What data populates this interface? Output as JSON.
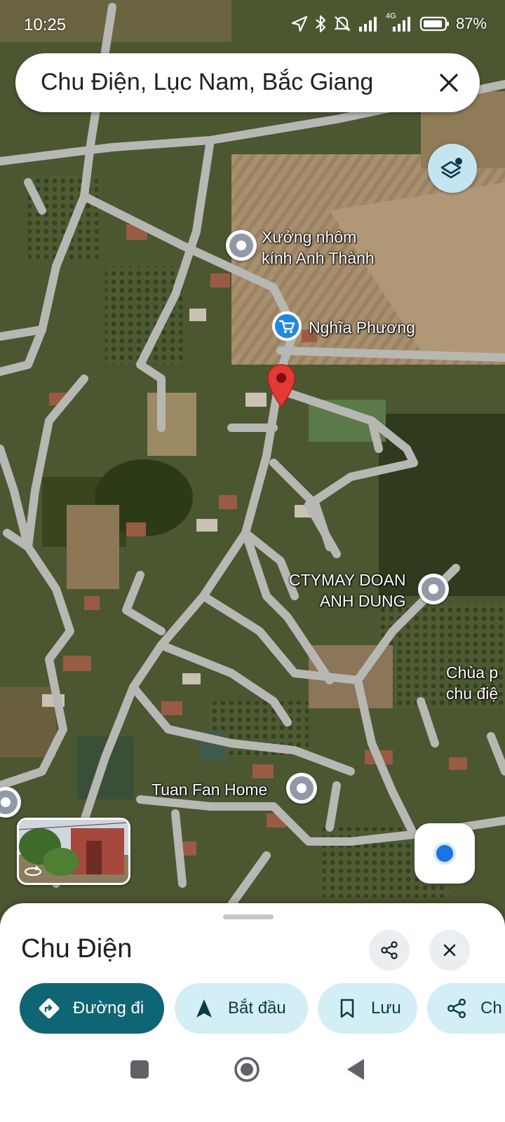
{
  "status_bar": {
    "time": "10:25",
    "network": "4G",
    "battery": "87%"
  },
  "search": {
    "query": "Chu Điện, Lục Nam, Bắc Giang",
    "clear_icon": "close-icon"
  },
  "map": {
    "layers_icon": "layers-icon",
    "selected_pin_color": "#e53935",
    "pois": [
      {
        "label": "Xưởng nhôm\nkính Anh Thành",
        "icon": "place-pin-gray"
      },
      {
        "label": "Nghĩa Phương",
        "icon": "shopping-cart-pin"
      },
      {
        "label": "CTYMAY DOAN\nANH DUNG",
        "icon": "place-pin-gray"
      },
      {
        "label": "Chùa p\nchu điệ",
        "icon": "none"
      },
      {
        "label": "Tuan Fan Home",
        "icon": "place-pin-gray"
      }
    ],
    "street_view_icon": "rotate-360-icon",
    "my_location_icon": "my-location-dot"
  },
  "sheet": {
    "title": "Chu Điện",
    "share_icon": "share-icon",
    "close_icon": "close-icon",
    "actions": [
      {
        "label": "Đường đi",
        "icon": "directions-icon",
        "primary": true
      },
      {
        "label": "Bắt đầu",
        "icon": "navigation-arrow-icon",
        "primary": false
      },
      {
        "label": "Lưu",
        "icon": "bookmark-icon",
        "primary": false
      },
      {
        "label": "Ch",
        "icon": "share-icon",
        "primary": false
      }
    ]
  },
  "nav_bar": {
    "buttons": [
      "recents-square",
      "home-circle",
      "back-triangle"
    ]
  },
  "colors": {
    "accent": "#0e6674",
    "chip_bg": "#d4eef6",
    "layers_bg": "#c3e4f1",
    "location_blue": "#1a73e8"
  }
}
